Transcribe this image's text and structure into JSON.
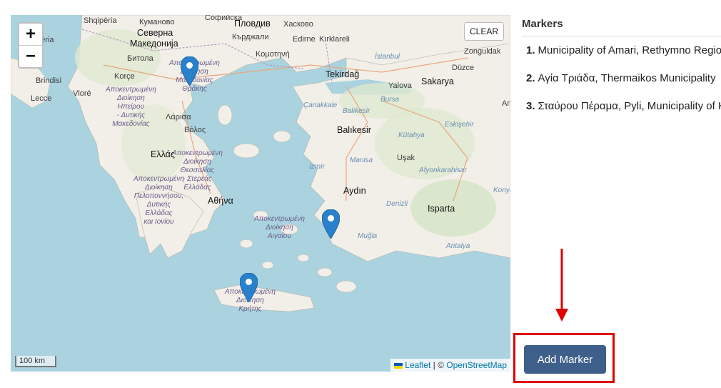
{
  "map": {
    "zoom_in": "+",
    "zoom_out": "−",
    "clear_label": "CLEAR",
    "scale_label": "100 km",
    "attribution": {
      "leaflet": "Leaflet",
      "separator": " | © ",
      "osm": "OpenStreetMap"
    },
    "labels": {
      "shqiperia": "Shqipëria",
      "kumanovo": "Куманово",
      "sofia_reg": "Софийска",
      "severna": "Северна",
      "makedonija": "Македонија",
      "bitola": "Битола",
      "korce": "Korçe",
      "brindisi": "Brindisi",
      "lecce": "Lecce",
      "vlore": "Vlorë",
      "plovdiv": "Пловдив",
      "kardzhali": "Кърджали",
      "haskovo": "Хасково",
      "edirne": "Edirne",
      "kirklareli": "Kırklareli",
      "komotini": "Κομοτηνή",
      "istanbul": "İstanbul",
      "tekirdag": "Tekirdağ",
      "zonguldak": "Zonguldak",
      "duzce": "Düzce",
      "sakarya": "Sakarya",
      "yalova": "Yalova",
      "bursa": "Bursa",
      "canakkale": "Çanakkale",
      "balikesir": "Balıkesir",
      "kutahya": "Kütahya",
      "eskisehir": "Eskişehir",
      "manisa": "Manisa",
      "usak": "Uşak",
      "izmir": "İzmir",
      "afyon": "Afyonkarahisar",
      "aydin": "Aydın",
      "denizli": "Denizli",
      "isparta": "Isparta",
      "mugla": "Muğla",
      "antalya": "Antalya",
      "konya": "Konya",
      "larisa": "Λάρισα",
      "volos": "Βόλος",
      "ellada": "Ελλάς",
      "athina": "Αθήνα",
      "makedonias_reg": "Αποκεντρωμένη\nΔιοίκηση\nΜακεδονίας\nΘράκης",
      "ipirou_reg": "Αποκεντρωμένη\nΔιοίκηση\nΗπείρου\n- Δυτικής\nΜακεδονίας",
      "thessalias_reg": "Αποκεντρωμένη\nΔιοίκηση\nΘεσσαλίας\n- Στερεάς\nΕλλάδας",
      "peloponnisou_reg": "Αποκεντρωμένη\nΔιοίκηση\nΠελοποννήσου,\nΔυτικής\nΕλλάδας\nκαι Ιονίου",
      "aigaiou_reg": "Αποκεντρωμένη\nΔιοίκηση\nΑιγαίου",
      "kritis_reg": "Αποκεντρωμένη\nΔιοίκηση\nΚρήτης",
      "balikesir_reg": "Balıkesir",
      "anatolia": "Ana"
    }
  },
  "panel": {
    "title": "Markers",
    "markers": [
      {
        "num": "1.",
        "label": "Municipality of Amari, Rethymno Regional Unit"
      },
      {
        "num": "2.",
        "label": "Αγία Τριάδα, Thermaikos Municipality"
      },
      {
        "num": "3.",
        "label": "Σταύρου Πέραμα, Pyli, Municipality of Kos"
      }
    ],
    "add_button": "Add Marker"
  },
  "colors": {
    "sea": "#aad3df",
    "land": "#f2efe9",
    "marker": "#2a81cb",
    "button": "#3e5f8a",
    "highlight": "#e00000"
  }
}
